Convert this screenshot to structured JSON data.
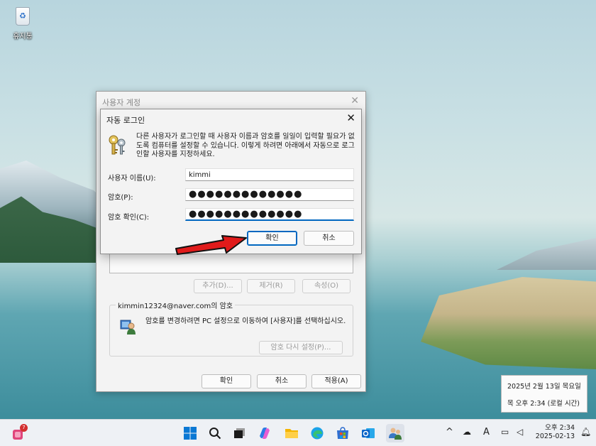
{
  "desktop": {
    "recycle_bin_label": "휴지통"
  },
  "parent_dialog": {
    "title": "사용자 계정",
    "buttons": {
      "add": "추가(D)...",
      "remove": "제거(R)",
      "properties": "속성(O)"
    },
    "password_group": {
      "title": "kimmin12324@naver.com의 암호",
      "text": "암호를 변경하려면 PC 설정으로 이동하여 [사용자]를 선택하십시오.",
      "reset_button": "암호 다시 설정(P)..."
    },
    "footer": {
      "ok": "확인",
      "cancel": "취소",
      "apply": "적용(A)"
    }
  },
  "autologin_dialog": {
    "title": "자동 로그인",
    "description": "다른 사용자가 로그인할 때 사용자 이름과 암호를 일일이 입력할 필요가 없도록 컴퓨터를 설정할 수 있습니다. 이렇게 하려면 아래에서 자동으로 로그인할 사용자를 지정하세요.",
    "username_label": "사용자 이름(U):",
    "username_value": "kimmi",
    "password_label": "암호(P):",
    "password_value": "●●●●●●●●●●●●●",
    "confirm_label": "암호 확인(C):",
    "confirm_value": "●●●●●●●●●●●●●",
    "ok": "확인",
    "cancel": "취소"
  },
  "clock_popup": {
    "date": "2025년 2월 13일 목요일",
    "time": "목 오후 2:34 (로컬 시간)"
  },
  "taskbar": {
    "badge_count": "7",
    "time": "오후 2:34",
    "date": "2025-02-13",
    "accent": "#0067c0"
  }
}
